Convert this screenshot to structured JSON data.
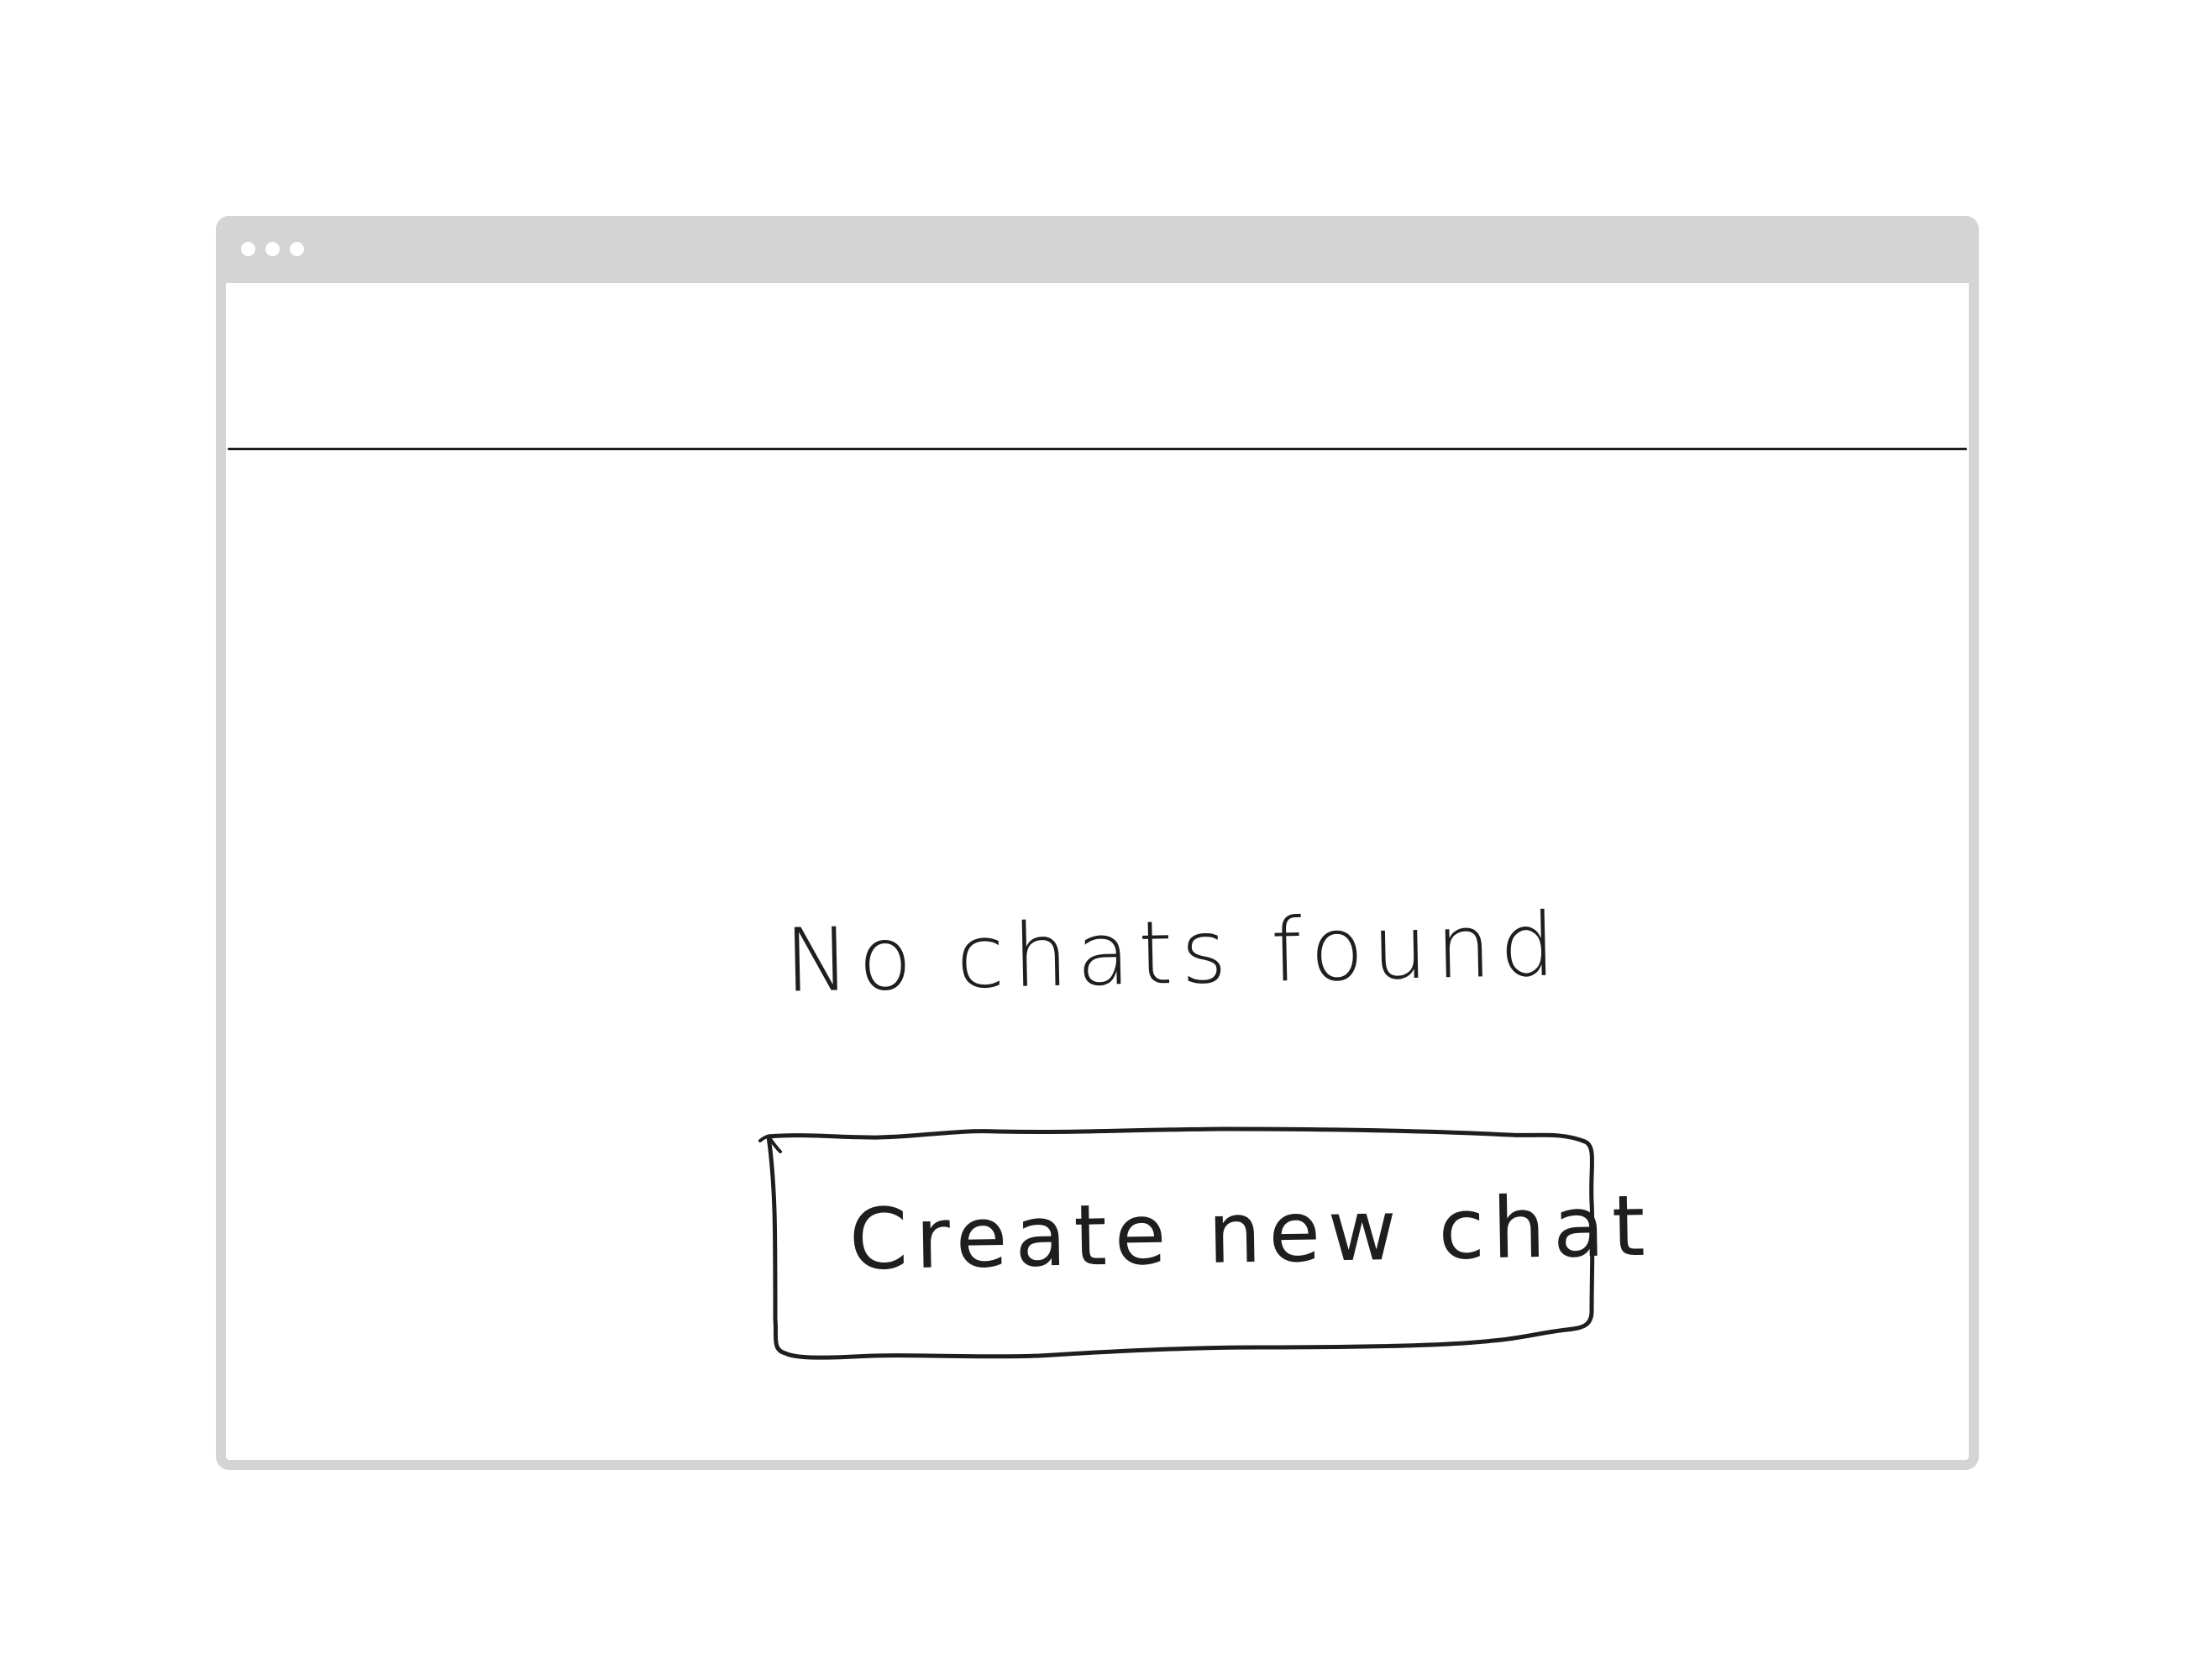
{
  "window": {
    "chrome_color": "#d4d4d4",
    "ink_color": "#1e1e1e",
    "title_bar_controls": [
      "dot",
      "dot",
      "dot"
    ]
  },
  "empty_state": {
    "message": "No chats found",
    "action_label": "Create new chat"
  }
}
